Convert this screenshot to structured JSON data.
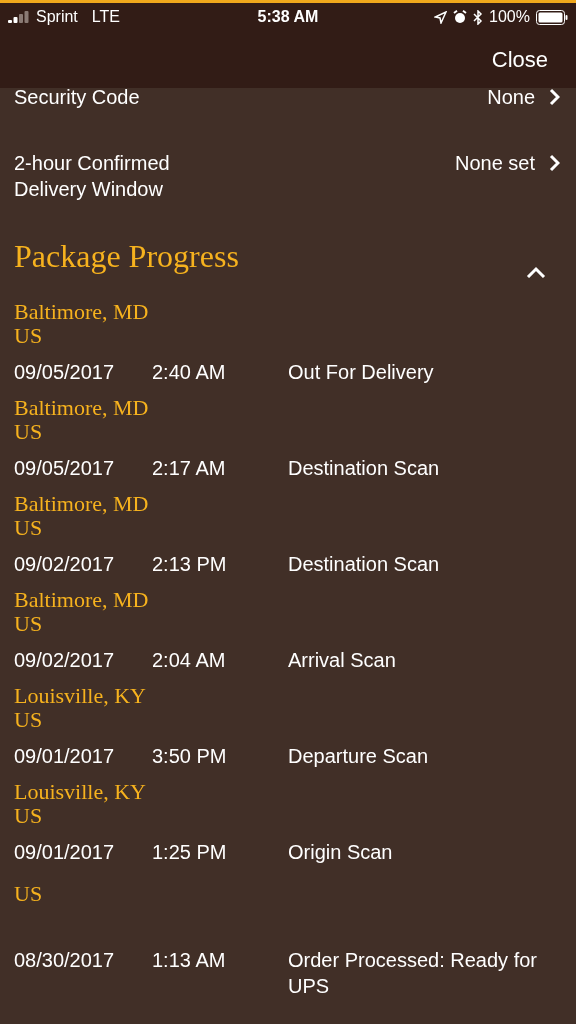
{
  "status_bar": {
    "carrier": "Sprint",
    "network": "LTE",
    "time": "5:38 AM",
    "battery": "100%"
  },
  "header": {
    "close": "Close"
  },
  "settings": [
    {
      "label": "Security Code",
      "value": "None"
    },
    {
      "label": "2-hour Confirmed Delivery Window",
      "value": "None set"
    }
  ],
  "progress": {
    "title": "Package Progress",
    "expanded": true,
    "events": [
      {
        "city": "Baltimore, MD",
        "country": "US",
        "date": "09/05/2017",
        "time": "2:40 AM",
        "activity": "Out For Delivery"
      },
      {
        "city": "Baltimore, MD",
        "country": "US",
        "date": "09/05/2017",
        "time": "2:17 AM",
        "activity": "Destination Scan"
      },
      {
        "city": "Baltimore, MD",
        "country": "US",
        "date": "09/02/2017",
        "time": "2:13 PM",
        "activity": "Destination Scan"
      },
      {
        "city": "Baltimore, MD",
        "country": "US",
        "date": "09/02/2017",
        "time": "2:04 AM",
        "activity": "Arrival Scan"
      },
      {
        "city": "Louisville, KY",
        "country": "US",
        "date": "09/01/2017",
        "time": "3:50 PM",
        "activity": "Departure Scan"
      },
      {
        "city": "Louisville, KY",
        "country": "US",
        "date": "09/01/2017",
        "time": "1:25 PM",
        "activity": "Origin Scan"
      },
      {
        "country": "US",
        "date": "08/30/2017",
        "time": "1:13 AM",
        "activity": "Order Processed: Ready for UPS"
      }
    ]
  }
}
